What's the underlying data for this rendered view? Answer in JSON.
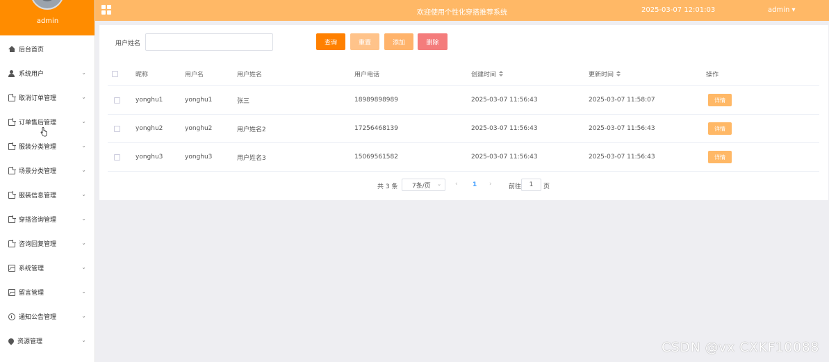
{
  "sidebar": {
    "username": "admin",
    "items": [
      {
        "label": "后台首页",
        "icon": "home-icon",
        "chevron": false
      },
      {
        "label": "系统用户",
        "icon": "user-icon",
        "chevron": true
      },
      {
        "label": "取消订单管理",
        "icon": "document-icon",
        "chevron": true
      },
      {
        "label": "订单售后管理",
        "icon": "document-icon",
        "chevron": true
      },
      {
        "label": "服装分类管理",
        "icon": "document-icon",
        "chevron": true
      },
      {
        "label": "场景分类管理",
        "icon": "document-icon",
        "chevron": true
      },
      {
        "label": "服装信息管理",
        "icon": "document-icon",
        "chevron": true
      },
      {
        "label": "穿搭咨询管理",
        "icon": "document-icon",
        "chevron": true
      },
      {
        "label": "咨询回复管理",
        "icon": "document-icon",
        "chevron": true
      },
      {
        "label": "系统管理",
        "icon": "picture-icon",
        "chevron": true
      },
      {
        "label": "留言管理",
        "icon": "picture-icon",
        "chevron": true
      },
      {
        "label": "通知公告管理",
        "icon": "info-icon",
        "chevron": true
      },
      {
        "label": "资源管理",
        "icon": "location-icon",
        "chevron": true
      }
    ]
  },
  "header": {
    "title": "欢迎使用个性化穿搭推荐系统",
    "datetime": "2025-03-07 12:01:03",
    "user": "admin ▾"
  },
  "search": {
    "label": "用户姓名",
    "value": "",
    "placeholder": ""
  },
  "toolbar": {
    "query_label": "查询",
    "reset_label": "重置",
    "add_label": "添加",
    "delete_label": "删除"
  },
  "table": {
    "columns": [
      "昵称",
      "用户名",
      "用户姓名",
      "用户电话",
      "创建时间",
      "更新时间",
      "操作"
    ],
    "rows": [
      {
        "nickname": "yonghu1",
        "username": "yonghu1",
        "name": "张三",
        "phone": "18989898989",
        "created": "2025-03-07 11:56:43",
        "updated": "2025-03-07 11:58:07",
        "action": "详情"
      },
      {
        "nickname": "yonghu2",
        "username": "yonghu2",
        "name": "用户姓名2",
        "phone": "17256468139",
        "created": "2025-03-07 11:56:43",
        "updated": "2025-03-07 11:56:43",
        "action": "详情"
      },
      {
        "nickname": "yonghu3",
        "username": "yonghu3",
        "name": "用户姓名3",
        "phone": "15069561582",
        "created": "2025-03-07 11:56:43",
        "updated": "2025-03-07 11:56:43",
        "action": "详情"
      }
    ]
  },
  "pagination": {
    "total": "共 3 条",
    "page_size": "7条/页",
    "current_page": "1",
    "goto_label": "前往",
    "goto_value": "1",
    "goto_unit": "页"
  },
  "watermark": "CSDN @vx  CXKF10088",
  "colors": {
    "sidebar_top": "#ff8c00",
    "header": "#ffb866",
    "query_button": "#ff8000",
    "reset_button": "#ffc38a",
    "add_button": "#ffb36b",
    "delete_button": "#f47c7c",
    "detail_button": "#ffb866",
    "active_page": "#409eff"
  }
}
